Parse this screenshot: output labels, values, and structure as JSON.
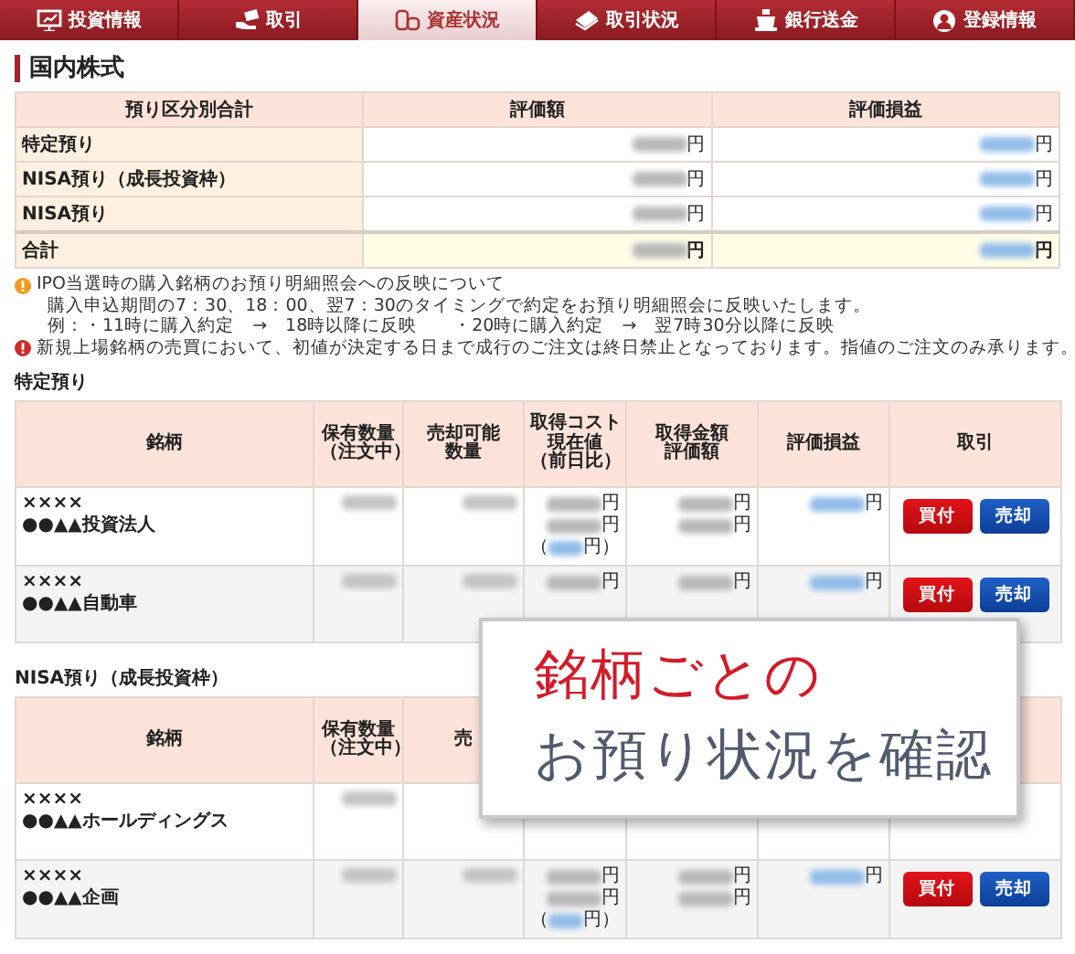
{
  "nav": {
    "tabs": [
      {
        "label": "投資情報",
        "kind": "board",
        "selected": false
      },
      {
        "label": "取引",
        "kind": "hand",
        "selected": false
      },
      {
        "label": "資産状況",
        "kind": "coins",
        "selected": true
      },
      {
        "label": "取引状況",
        "kind": "notes",
        "selected": false
      },
      {
        "label": "銀行送金",
        "kind": "pot",
        "selected": false
      },
      {
        "label": "登録情報",
        "kind": "user",
        "selected": false
      }
    ]
  },
  "heading": "国内株式",
  "summary": {
    "columns": [
      "預り区分別合計",
      "評価額",
      "評価損益"
    ],
    "rows": [
      {
        "kind": "normal",
        "label": "特定預り",
        "value": {
          "unit": "円"
        },
        "pnl": {
          "unit": "円"
        }
      },
      {
        "kind": "normal",
        "label": "NISA預り（成長投資枠）",
        "value": {
          "unit": "円"
        },
        "pnl": {
          "unit": "円"
        }
      },
      {
        "kind": "normal",
        "label": "NISA預り",
        "value": {
          "unit": "円"
        },
        "pnl": {
          "unit": "円"
        }
      },
      {
        "kind": "total",
        "label": "合計",
        "value": {
          "unit": "円"
        },
        "pnl": {
          "unit": "円"
        }
      }
    ]
  },
  "notices": [
    {
      "kind": "info",
      "lines": [
        "IPO当選時の購入銘柄のお預り明細照会への反映について",
        "購入申込期間の7：30、18：00、翌7：30のタイミングで約定をお預り明細照会に反映いたします。",
        "例：・11時に購入約定　→　18時以降に反映　　・20時に購入約定　→　翌7時30分以降に反映"
      ]
    },
    {
      "kind": "alert",
      "lines": [
        "新規上場銘柄の売買において、初値が決定する日まで成行のご注文は終日禁止となっております。指値のご注文のみ承ります。"
      ]
    }
  ],
  "holdings": [
    {
      "title": "特定預り",
      "columns": [
        {
          "lines": [
            "銘柄"
          ]
        },
        {
          "lines": [
            "保有数量",
            "（注文中）"
          ]
        },
        {
          "lines": [
            "売却可能",
            "数量"
          ]
        },
        {
          "lines": [
            "取得コスト",
            "現在値",
            "（前日比）"
          ]
        },
        {
          "lines": [
            "取得金額",
            "評価額"
          ]
        },
        {
          "lines": [
            "評価損益"
          ]
        },
        {
          "lines": [
            "取引"
          ]
        }
      ],
      "rows": [
        {
          "code": "××××",
          "name": "●●▲▲投資法人",
          "quantity_blurred": true,
          "sellable_blurred": true,
          "cost": [
            {
              "unit": "円"
            },
            {
              "unit": "円"
            },
            {
              "prefix": "（",
              "unit": "円）"
            }
          ],
          "amount": [
            {
              "unit": "円"
            },
            {
              "unit": "円"
            }
          ],
          "pnl": [
            {
              "unit": "円"
            }
          ],
          "buttons": [
            {
              "label": "買付",
              "kind": "buy"
            },
            {
              "label": "売却",
              "kind": "sell"
            }
          ]
        },
        {
          "code": "××××",
          "name": "●●▲▲自動車",
          "quantity_blurred": true,
          "sellable_blurred": true,
          "cost": [
            {
              "unit": "円"
            }
          ],
          "amount": [
            {
              "unit": "円"
            }
          ],
          "pnl": [
            {
              "unit": "円"
            }
          ],
          "buttons": [
            {
              "label": "買付",
              "kind": "buy"
            },
            {
              "label": "売却",
              "kind": "sell"
            }
          ]
        }
      ]
    },
    {
      "title": "NISA預り（成長投資枠）",
      "columns": [
        {
          "lines": [
            "銘柄"
          ]
        },
        {
          "lines": [
            "保有数量",
            "（注文中）"
          ]
        },
        {
          "lines": [
            "売"
          ]
        }
      ],
      "rows": [
        {
          "code": "××××",
          "name": "●●▲▲ホールディングス",
          "quantity_blurred": true
        },
        {
          "code": "××××",
          "name": "●●▲▲企画",
          "quantity_blurred": true,
          "sellable_blurred": true,
          "cost": [
            {
              "unit": "円"
            },
            {
              "unit": "円"
            },
            {
              "prefix": "（",
              "unit": "円）"
            }
          ],
          "amount": [
            {
              "unit": "円"
            },
            {
              "unit": "円"
            }
          ],
          "pnl": [
            {
              "unit": "円"
            }
          ],
          "buttons": [
            {
              "label": "買付",
              "kind": "buy"
            },
            {
              "label": "売却",
              "kind": "sell"
            }
          ]
        }
      ]
    }
  ],
  "promo": {
    "lines": [
      {
        "text": "銘柄ごとの",
        "kind": "accent"
      },
      {
        "text": "お預り状況を確認",
        "kind": "plain"
      }
    ]
  }
}
